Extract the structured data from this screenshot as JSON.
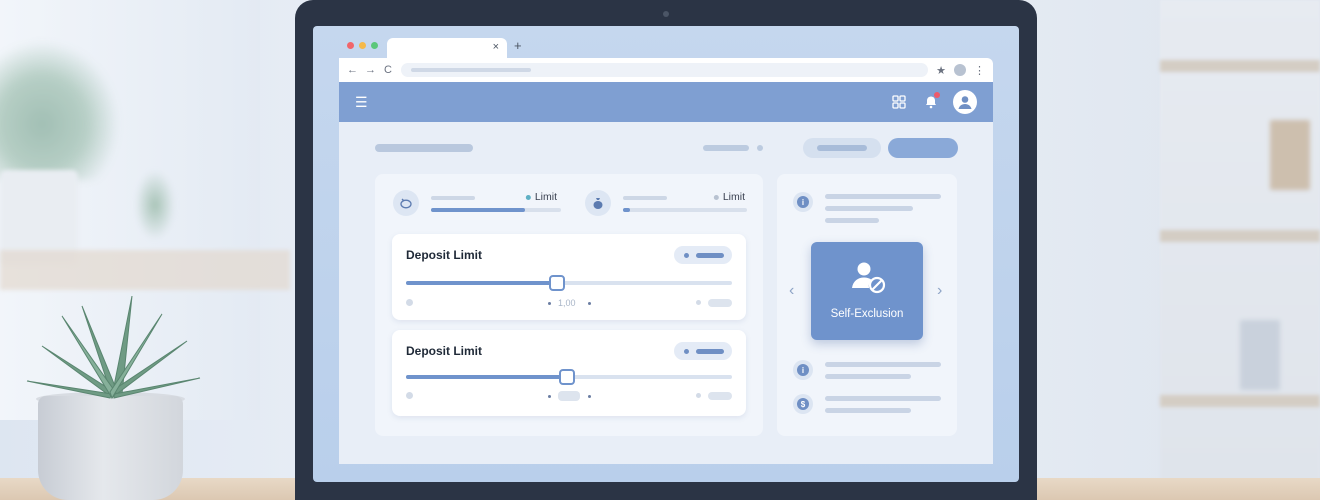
{
  "colors": {
    "app_bar": "#7f9fd2",
    "accent": "#6f93cc",
    "feature_card": "#6f93cc",
    "notification_badge": "#ef5a6a",
    "traffic_lights": [
      "#f1656a",
      "#f5b94a",
      "#5bc77a"
    ]
  },
  "browser": {
    "tab_close": "×",
    "new_tab": "+",
    "nav": {
      "back": "←",
      "forward": "→",
      "reload": "C"
    },
    "star": "★",
    "kebab": "⋮"
  },
  "appbar": {
    "menu_glyph": "☰",
    "icons": [
      "menu-icon",
      "grid-icon",
      "bell-icon",
      "user-icon"
    ],
    "notification_badge": true
  },
  "summary": {
    "stats": [
      {
        "icon": "piggy-bank-icon",
        "label": "Limit",
        "progress": 0.72,
        "dot_color": "#5fb0c4"
      },
      {
        "icon": "money-bag-icon",
        "label": "Limit",
        "progress": 0.06,
        "dot_color": "#b8c2d1"
      }
    ]
  },
  "limits": [
    {
      "title": "Deposit Limit",
      "slider_value": 0.46,
      "value_text": "1,00"
    },
    {
      "title": "Deposit Limit",
      "slider_value": 0.49,
      "value_text": ""
    }
  ],
  "sidebar": {
    "feature": {
      "label": "Self-Exclusion",
      "icon": "user-blocked-icon"
    },
    "info_rows": [
      {
        "icon": "info-icon",
        "glyph": "i"
      },
      {
        "icon": "info-icon",
        "glyph": "i"
      },
      {
        "icon": "dollar-icon",
        "glyph": "$"
      }
    ],
    "prev_arrow": "‹",
    "next_arrow": "›"
  }
}
